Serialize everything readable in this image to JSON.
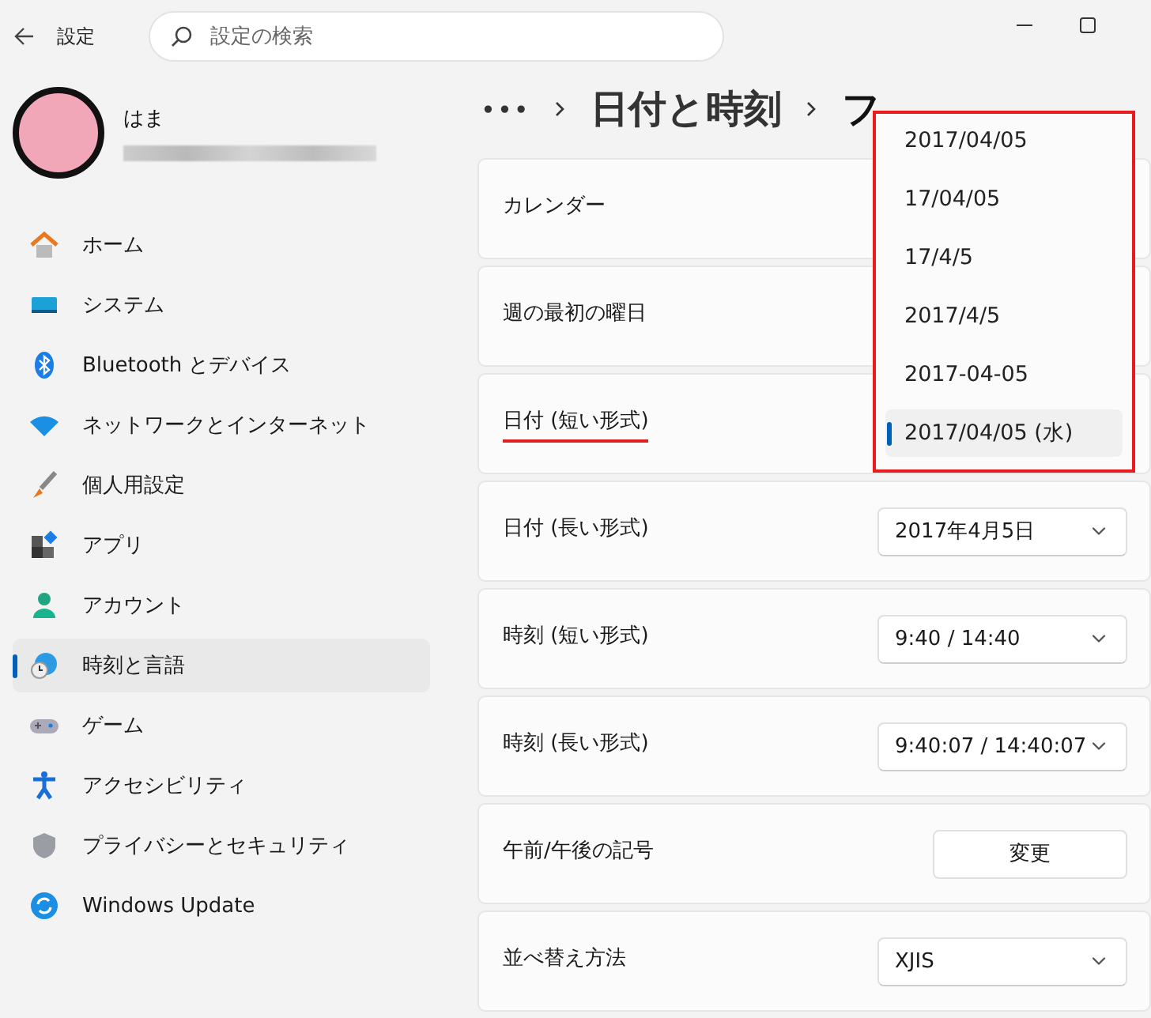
{
  "window": {
    "title": "設定"
  },
  "search": {
    "placeholder": "設定の検索"
  },
  "user": {
    "name": "はま"
  },
  "sidebar": {
    "items": [
      {
        "label": "ホーム",
        "selected": false
      },
      {
        "label": "システム",
        "selected": false
      },
      {
        "label": "Bluetooth とデバイス",
        "selected": false
      },
      {
        "label": "ネットワークとインターネット",
        "selected": false
      },
      {
        "label": "個人用設定",
        "selected": false
      },
      {
        "label": "アプリ",
        "selected": false
      },
      {
        "label": "アカウント",
        "selected": false
      },
      {
        "label": "時刻と言語",
        "selected": true
      },
      {
        "label": "ゲーム",
        "selected": false
      },
      {
        "label": "アクセシビリティ",
        "selected": false
      },
      {
        "label": "プライバシーとセキュリティ",
        "selected": false
      },
      {
        "label": "Windows Update",
        "selected": false
      }
    ]
  },
  "breadcrumb": {
    "overflow": "•••",
    "items": [
      "日付と時刻",
      "フ"
    ]
  },
  "settings": [
    {
      "label": "カレンダー",
      "kind": "plain",
      "underlined": false
    },
    {
      "label": "週の最初の曜日",
      "kind": "plain",
      "underlined": false
    },
    {
      "label": "日付 (短い形式)",
      "kind": "plain",
      "underlined": true
    },
    {
      "label": "日付 (長い形式)",
      "kind": "dropdown",
      "value": "2017年4月5日",
      "underlined": false
    },
    {
      "label": "時刻 (短い形式)",
      "kind": "dropdown",
      "value": "9:40 / 14:40",
      "underlined": false
    },
    {
      "label": "時刻 (長い形式)",
      "kind": "dropdown",
      "value": "9:40:07 / 14:40:07",
      "underlined": false
    },
    {
      "label": "午前/午後の記号",
      "kind": "button",
      "value": "変更",
      "underlined": false
    },
    {
      "label": "並べ替え方法",
      "kind": "dropdown",
      "value": "XJIS",
      "underlined": false
    }
  ],
  "open_dropdown": {
    "options": [
      {
        "label": "2017/04/05",
        "selected": false
      },
      {
        "label": "17/04/05",
        "selected": false
      },
      {
        "label": "17/4/5",
        "selected": false
      },
      {
        "label": "2017/4/5",
        "selected": false
      },
      {
        "label": "2017-04-05",
        "selected": false
      },
      {
        "label": "2017/04/05 (水)",
        "selected": true
      }
    ]
  }
}
